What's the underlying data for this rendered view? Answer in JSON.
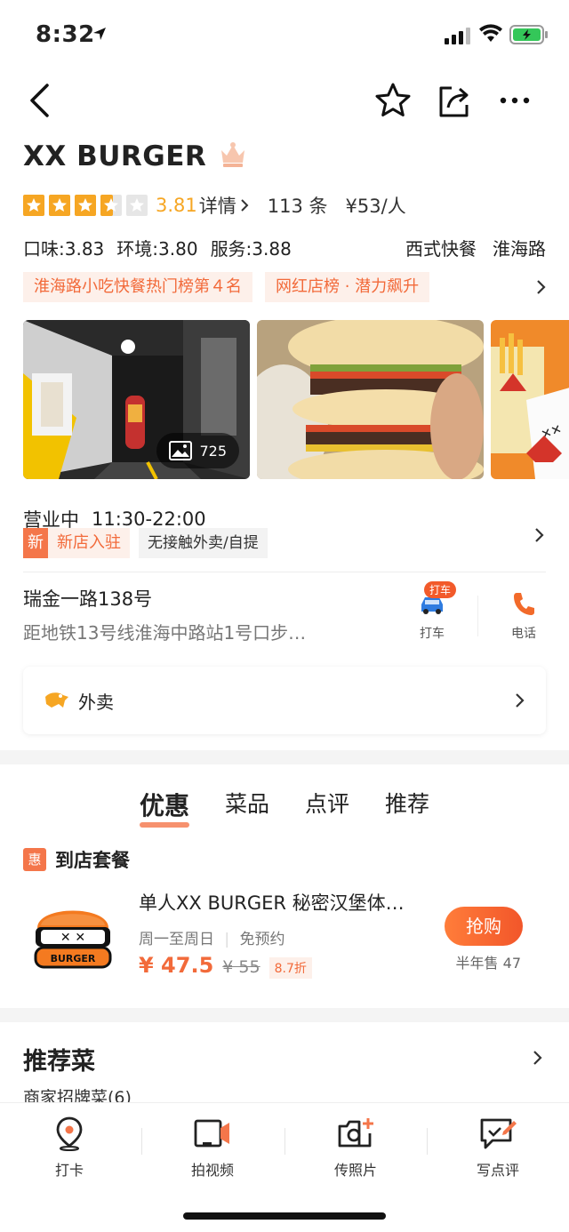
{
  "status": {
    "time": "8:32"
  },
  "shop": {
    "name": "XX BURGER",
    "score": "3.81",
    "detail_link": "详情",
    "review_count": "113 条",
    "avg_price": "¥53/人",
    "subscores": {
      "taste": "口味:3.83",
      "env": "环境:3.80",
      "service": "服务:3.88"
    },
    "category": "西式快餐",
    "area": "淮海路",
    "rank_tags": [
      "淮海路小吃快餐热门榜第４名",
      "网红店榜 · 潜力飙升"
    ],
    "photo_count": "725",
    "open_status": "营业中",
    "hours": "11:30-22:00",
    "new_badge": "新",
    "new_text": "新店入驻",
    "service_tag": "无接触外卖/自提",
    "address": "瑞金一路138号",
    "metro": "距地铁13号线淮海中路站1号口步…",
    "taxi_pill": "打车",
    "taxi_label": "打车",
    "phone_label": "电话",
    "takeout_label": "外卖"
  },
  "tabs": [
    "优惠",
    "菜品",
    "点评",
    "推荐"
  ],
  "deal_section": {
    "badge": "惠",
    "title": "到店套餐"
  },
  "deal": {
    "title": "单人XX BURGER 秘密汉堡体…",
    "days": "周一至周日",
    "reserve": "免预约",
    "price_now": "¥ 47.5",
    "price_old": "¥ 55",
    "discount": "8.7折",
    "buy_label": "抢购",
    "sold": "半年售 47",
    "logo_text": "BURGER"
  },
  "recommend": {
    "title": "推荐菜",
    "subtitle": "商家招牌菜(6)"
  },
  "bottom_bar": [
    "打卡",
    "拍视频",
    "传照片",
    "写点评"
  ],
  "colors": {
    "accent": "#f4764a",
    "star": "#f6a623"
  },
  "icons": [
    "back-icon",
    "star-outline-icon",
    "share-icon",
    "more-icon",
    "chevron-right-icon",
    "image-icon",
    "taxi-icon",
    "phone-icon",
    "delivery-icon",
    "location-pin-icon",
    "video-icon",
    "camera-icon",
    "write-review-icon"
  ]
}
